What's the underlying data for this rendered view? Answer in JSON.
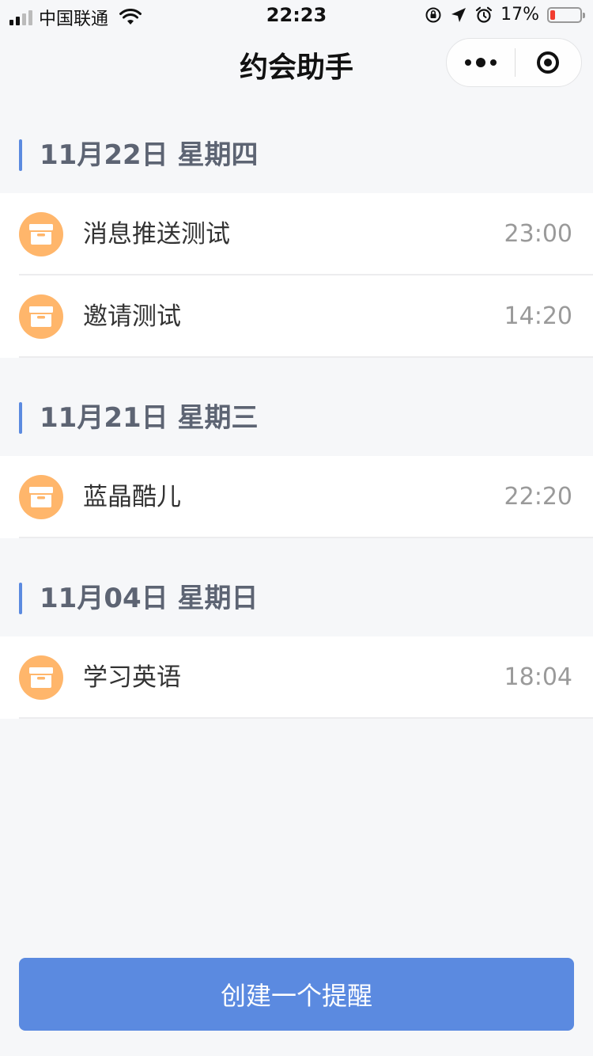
{
  "status_bar": {
    "carrier": "中国联通",
    "time": "22:23",
    "battery_percent": "17%",
    "battery_level": 0.17,
    "battery_color": "#f23c2f"
  },
  "nav": {
    "title": "约会助手",
    "more_icon": "more-dots-icon",
    "close_icon": "target-circle-icon"
  },
  "sections": [
    {
      "date": "11月22日 星期四",
      "items": [
        {
          "title": "消息推送测试",
          "time": "23:00",
          "icon": "box-icon"
        },
        {
          "title": "邀请测试",
          "time": "14:20",
          "icon": "box-icon"
        }
      ]
    },
    {
      "date": "11月21日 星期三",
      "items": [
        {
          "title": "蓝晶酷儿",
          "time": "22:20",
          "icon": "box-icon"
        }
      ]
    },
    {
      "date": "11月04日 星期日",
      "items": [
        {
          "title": "学习英语",
          "time": "18:04",
          "icon": "box-icon"
        }
      ]
    }
  ],
  "create_button_label": "创建一个提醒",
  "colors": {
    "accent": "#5b8ae0",
    "icon_bg": "#ffb66b",
    "background": "#f6f7f9"
  }
}
